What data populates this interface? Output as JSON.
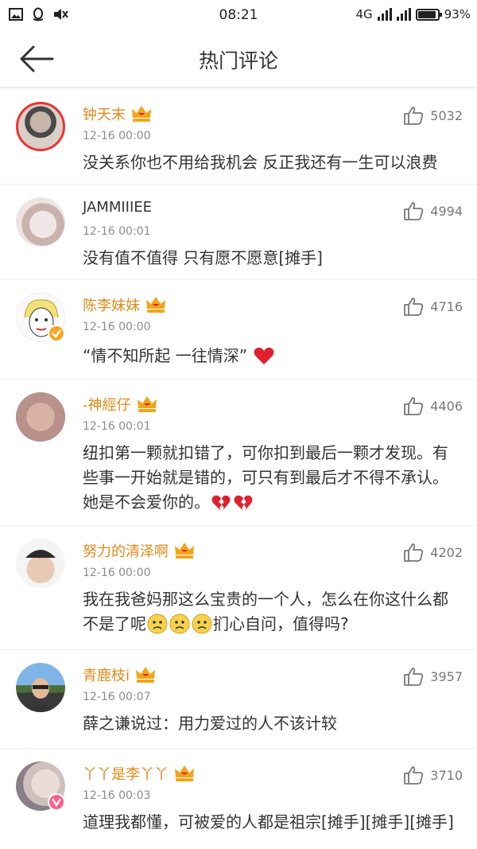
{
  "status_bar": {
    "time": "08:21",
    "network": "4G",
    "battery": "93%",
    "battery_level": 0.93,
    "icons": [
      "image-icon",
      "qq-icon",
      "mute-icon"
    ]
  },
  "header": {
    "title": "热门评论",
    "back_icon": "arrow-left-icon"
  },
  "colors": {
    "username": "#e08a1a",
    "plain_username": "#333333",
    "timestamp": "#8c8c8c",
    "crown": "#f2a51a",
    "heart": "#e0212d",
    "verified_badge": "#f5a623",
    "girl_badge": "#ff5c8a"
  },
  "comments": [
    {
      "username": "钟天末",
      "vip": true,
      "time": "12-16 00:00",
      "likes": "5032",
      "text": "没关系你也不用给我机会 反正我还有一生可以浪费"
    },
    {
      "username": "JAMMIIIEE",
      "vip": false,
      "time": "12-16 00:01",
      "likes": "4994",
      "text": "没有值不值得 只有愿不愿意[摊手]"
    },
    {
      "username": "陈李妹妹",
      "vip": true,
      "time": "12-16 00:00",
      "likes": "4716",
      "text": "“情不知所起 一往情深”",
      "badge": "verified"
    },
    {
      "username": "-神經仔",
      "vip": true,
      "time": "12-16 00:01",
      "likes": "4406",
      "text": "纽扣第一颗就扣错了，可你扣到最后一颗才发现。有些事一开始就是错的，可只有到最后才不得不承认。她是不会爱你的。"
    },
    {
      "username": "努力的清泽啊",
      "vip": true,
      "time": "12-16 00:00",
      "likes": "4202",
      "text_a": "我在我爸妈那这么宝贵的一个人，怎么在你这什么都不是了呢",
      "text_b": "扪心自问，值得吗?"
    },
    {
      "username": "青鹿枝i",
      "vip": true,
      "time": "12-16 00:07",
      "likes": "3957",
      "text": "薛之谦说过：用力爱过的人不该计较"
    },
    {
      "username": "丫丫是李丫丫",
      "vip": true,
      "time": "12-16 00:03",
      "likes": "3710",
      "text": "道理我都懂，可被爱的人都是祖宗[摊手][摊手][摊手]",
      "badge": "girl"
    }
  ]
}
